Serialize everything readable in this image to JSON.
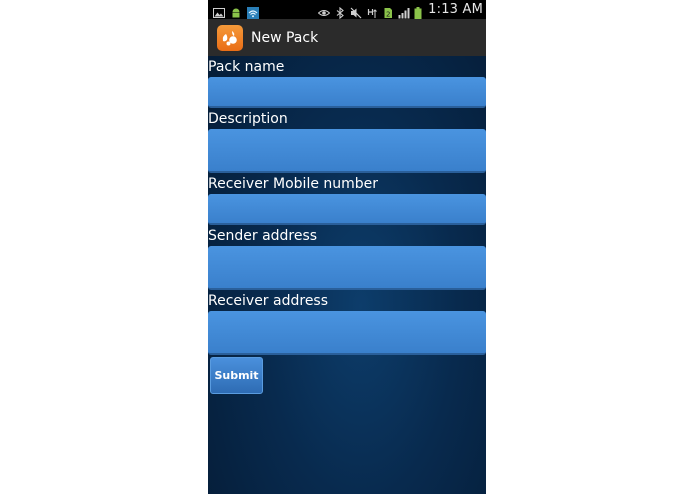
{
  "status_bar": {
    "time": "1:13 AM",
    "icons": [
      "image-icon",
      "android-icon",
      "wifi-icon",
      "eye-icon",
      "bluetooth-icon",
      "mute-icon",
      "hsdpa-icon",
      "sim-icon",
      "signal-icon",
      "battery-icon"
    ]
  },
  "action_bar": {
    "title": "New Pack",
    "app_icon": "app-logo-icon"
  },
  "form": {
    "fields": [
      {
        "label": "Pack name",
        "value": "",
        "placeholder": ""
      },
      {
        "label": "Description",
        "value": "",
        "placeholder": ""
      },
      {
        "label": "Receiver Mobile number",
        "value": "",
        "placeholder": ""
      },
      {
        "label": "Sender address",
        "value": "",
        "placeholder": ""
      },
      {
        "label": "Receiver address",
        "value": "",
        "placeholder": ""
      }
    ],
    "submit_label": "Submit"
  },
  "colors": {
    "background": "#082a4e",
    "input": "#4a94e0",
    "action_bar": "#2b2b2b",
    "app_icon": "#ef7f22"
  }
}
